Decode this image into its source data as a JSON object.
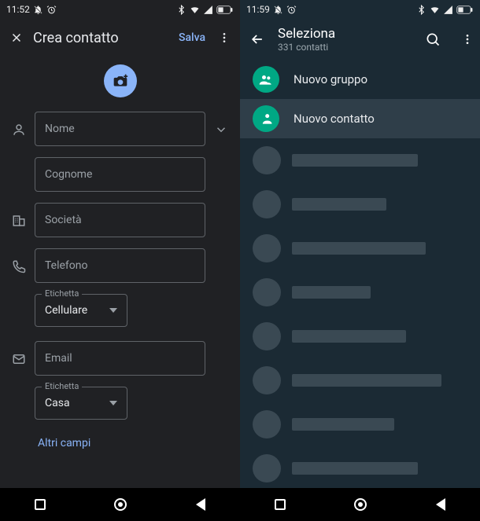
{
  "left": {
    "status_time": "11:52",
    "appbar_title": "Crea contatto",
    "save_label": "Salva",
    "name_placeholder": "Nome",
    "surname_placeholder": "Cognome",
    "company_placeholder": "Società",
    "phone_placeholder": "Telefono",
    "phone_label_caption": "Etichetta",
    "phone_label_value": "Cellulare",
    "email_placeholder": "Email",
    "email_label_caption": "Etichetta",
    "email_label_value": "Casa",
    "more_fields": "Altri campi"
  },
  "right": {
    "status_time": "11:59",
    "appbar_title": "Seleziona",
    "appbar_subtitle": "331 contatti",
    "new_group": "Nuovo gruppo",
    "new_contact": "Nuovo contatto",
    "placeholder_widths": [
      160,
      120,
      170,
      100,
      145,
      190,
      130,
      160
    ]
  }
}
